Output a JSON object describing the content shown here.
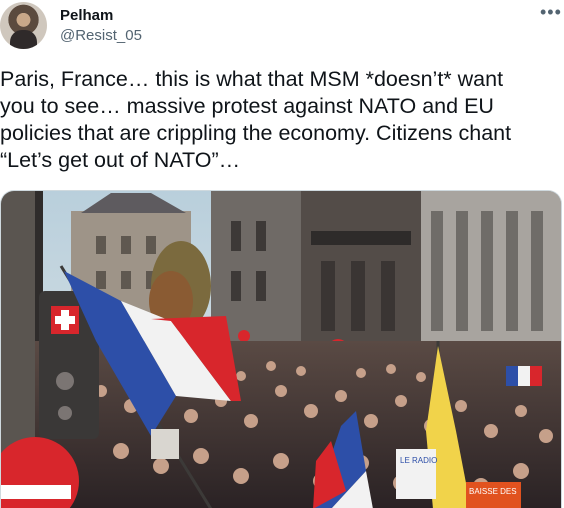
{
  "tweet": {
    "author": {
      "display_name": "Pelham",
      "handle": "@Resist_05"
    },
    "more_icon": "ellipsis-icon",
    "text": "Paris, France… this is what that MSM *doesn’t* want\nyou to see… massive protest against NATO and EU\npolicies that are crippling the economy. Citizens chant\n“Let’s get out of NATO”…",
    "media": {
      "type": "photo",
      "signs": [
        "LE RADIO",
        "BAISSE DES"
      ]
    }
  },
  "colors": {
    "text": "#0f1419",
    "secondary": "#536471",
    "flag_blue": "#2d4fa8",
    "flag_red": "#d8262c",
    "flag_yellow": "#f1d34a"
  }
}
